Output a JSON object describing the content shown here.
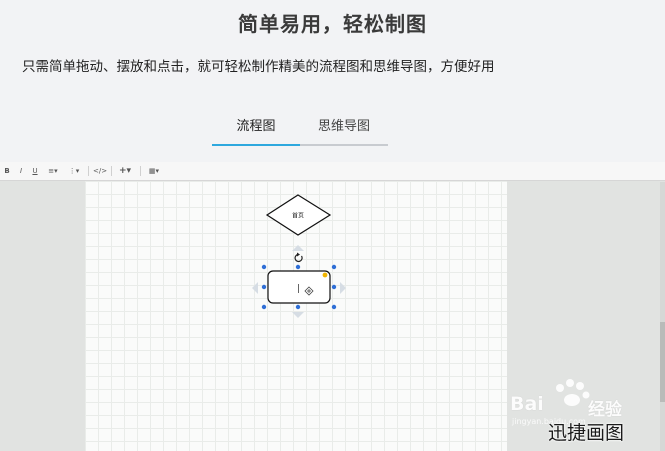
{
  "header": {
    "title": "简单易用，轻松制图",
    "subtitle": "只需简单拖动、摆放和点击，就可轻松制作精美的流程图和思维导图，方便好用",
    "tabs": [
      {
        "label": "流程图",
        "active": true
      },
      {
        "label": "思维导图",
        "active": false
      }
    ],
    "accent_color": "#2ea8de"
  },
  "toolbar": {
    "bold": "B",
    "italic": "I",
    "underline": "U",
    "align": "≡▾",
    "spacing": "⋮▾",
    "code": "</>",
    "insert": "+▾",
    "table": "▦▾"
  },
  "diagram": {
    "diamond_label": "首页",
    "selected_shape_cursor": "|"
  },
  "watermark": {
    "baidu": "Bai",
    "jingyan": "经验",
    "url": "jingyan.baidu.com",
    "brand": "迅捷画图"
  }
}
